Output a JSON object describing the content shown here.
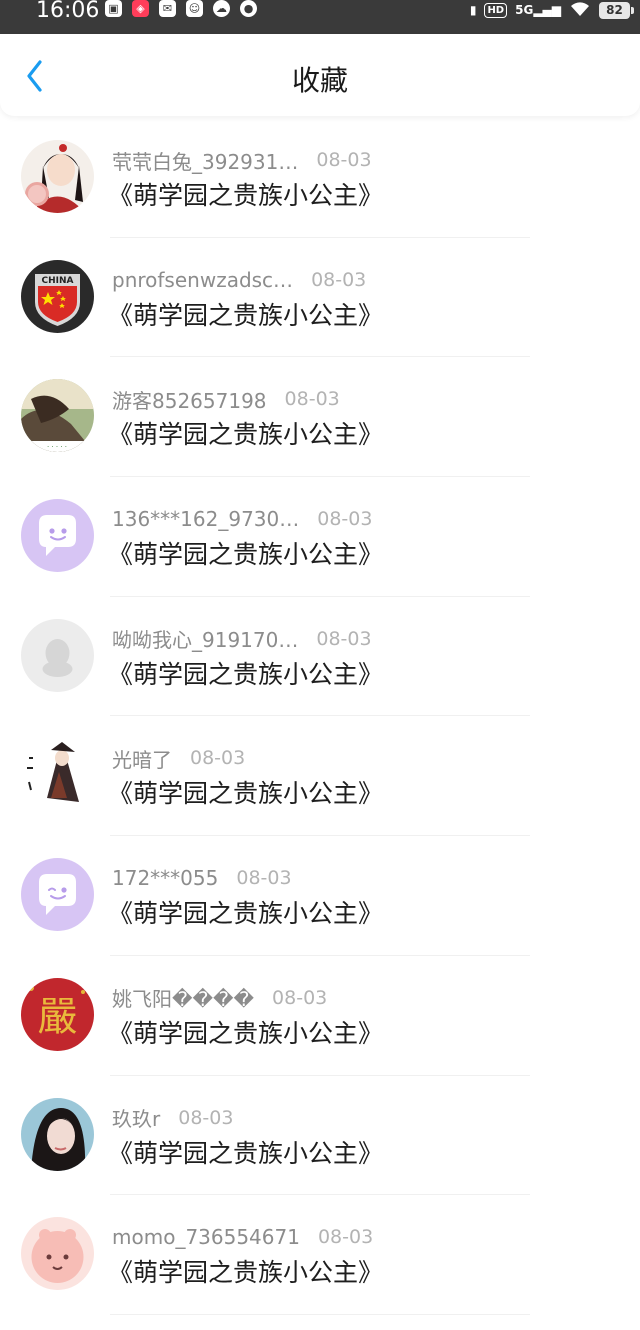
{
  "status_bar": {
    "time": "16:06",
    "network": "5G",
    "hd": "HD",
    "battery": "82"
  },
  "header": {
    "title": "收藏",
    "back_icon": "chevron-left-icon",
    "accent_color": "#1a9cf0"
  },
  "items": [
    {
      "user": "茕茕白兔_392931…",
      "date": "08-03",
      "title": "《萌学园之贵族小公主》"
    },
    {
      "user": "pnrofsenwzadsc…",
      "date": "08-03",
      "title": "《萌学园之贵族小公主》"
    },
    {
      "user": "游客852657198",
      "date": "08-03",
      "title": "《萌学园之贵族小公主》"
    },
    {
      "user": "136***162_9730…",
      "date": "08-03",
      "title": "《萌学园之贵族小公主》"
    },
    {
      "user": "呦呦我心_919170…",
      "date": "08-03",
      "title": "《萌学园之贵族小公主》"
    },
    {
      "user": "光暗了",
      "date": "08-03",
      "title": "《萌学园之贵族小公主》"
    },
    {
      "user": "172***055",
      "date": "08-03",
      "title": "《萌学园之贵族小公主》"
    },
    {
      "user": "姚飞阳����",
      "date": "08-03",
      "title": "《萌学园之贵族小公主》"
    },
    {
      "user": "玖玖r",
      "date": "08-03",
      "title": "《萌学园之贵族小公主》"
    },
    {
      "user": "momo_736554671",
      "date": "08-03",
      "title": "《萌学园之贵族小公主》"
    }
  ],
  "avatar_texts": {
    "china_badge": "CHINA",
    "red_char": "嚴"
  }
}
